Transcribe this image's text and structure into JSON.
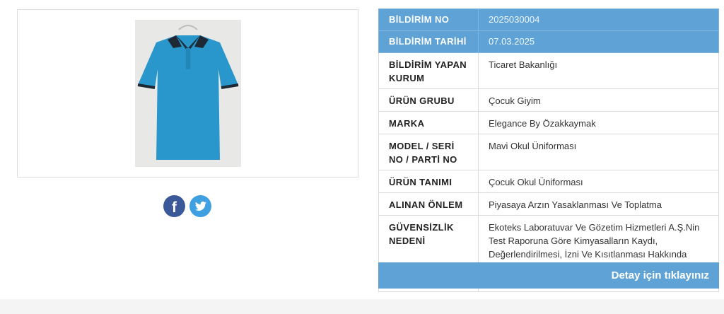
{
  "notification": {
    "rows": [
      {
        "label": "BİLDİRİM NO",
        "value": "2025030004"
      },
      {
        "label": "BİLDİRİM TARİHİ",
        "value": "07.03.2025"
      },
      {
        "label": "BİLDİRİM YAPAN KURUM",
        "value": "Ticaret Bakanlığı"
      },
      {
        "label": "ÜRÜN GRUBU",
        "value": "Çocuk Giyim"
      },
      {
        "label": "MARKA",
        "value": "Elegance By Özakkaymak"
      },
      {
        "label": "MODEL / SERİ NO / PARTİ NO",
        "value": "Mavi Okul Üniforması"
      },
      {
        "label": "ÜRÜN TANIMI",
        "value": "Çocuk Okul Üniforması"
      },
      {
        "label": "ALINAN ÖNLEM",
        "value": "Piyasaya Arzın Yasaklanması Ve Toplatma"
      },
      {
        "label": "GÜVENSİZLİK NEDENİ",
        "value": "Ekoteks Laboratuvar Ve Gözetim Hizmetleri A.Ş.Nin Test Raporuna Göre Kimyasalların Kaydı, Değerlendirilmesi, İzni Ve Kısıtlanması Hakkında Yönetmelik Kapsamında Yapılan Analizde Ekoloji Testleri Kurşun (Pb) Kısmından Kalır Sonuç Almıştır."
      }
    ],
    "detail_button": "Detay için tıklayınız"
  },
  "share": {
    "facebook_icon": "facebook-icon",
    "twitter_icon": "twitter-icon"
  },
  "colors": {
    "header_blue": "#5fa3d6",
    "facebook": "#3b5998",
    "twitter": "#3e9fe1",
    "shirt": "#2a97cc"
  }
}
